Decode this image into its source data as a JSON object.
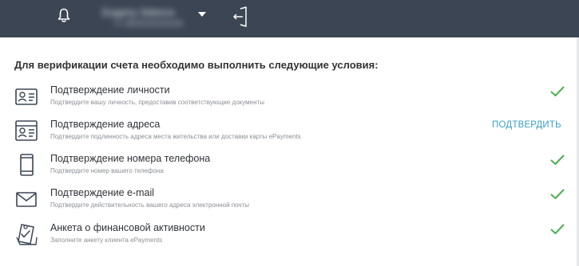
{
  "header": {
    "account_name": "Evgeny Sidorov",
    "account_sub": "+7 9XXXXXXXXX",
    "icons": [
      "bell-icon",
      "chevron-down-icon",
      "logout-icon"
    ]
  },
  "intro": "Для верификации счета необходимо выполнить следующие условия:",
  "items": [
    {
      "title": "Подтверждение личности",
      "desc": "Подтвердите вашу личность, предоставив соответствующие документы",
      "status": "done",
      "icon": "id-card-icon"
    },
    {
      "title": "Подтверждение адреса",
      "desc": "Подтвердите подлинность адреса места жительства или доставки карты ePayments",
      "status": "pending",
      "action": "ПОДТВЕРДИТЬ",
      "icon": "address-card-icon"
    },
    {
      "title": "Подтверждение номера телефона",
      "desc": "Подтвердите номер вашего телефона",
      "status": "done",
      "icon": "phone-icon"
    },
    {
      "title": "Подтверждение e-mail",
      "desc": "Подтвердите действительность вашего адреса электронной почты",
      "status": "done",
      "icon": "envelope-icon"
    },
    {
      "title": "Анкета о финансовой активности",
      "desc": "Заполните анкету клиента ePayments",
      "status": "done",
      "icon": "questionnaire-icon"
    }
  ],
  "colors": {
    "header_bg": "#3b4554",
    "check": "#4caf50",
    "link": "#3aa0c8"
  }
}
